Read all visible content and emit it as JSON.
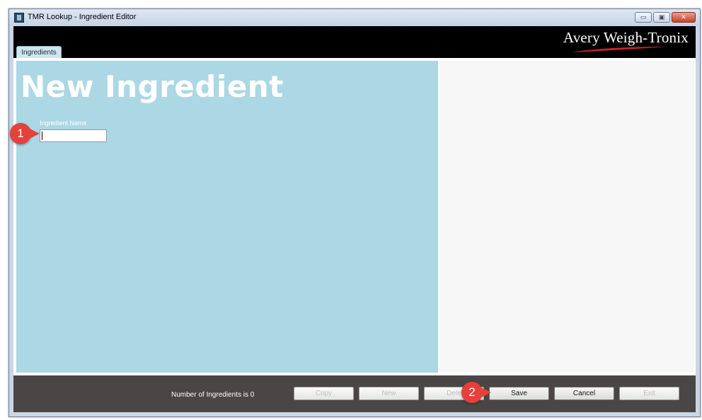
{
  "window": {
    "title": "TMR Lookup - Ingredient Editor",
    "controls": {
      "minimize": "▭",
      "maximize": "▣",
      "close": "✕"
    }
  },
  "header": {
    "logo_text": "Avery Weigh-Tronix",
    "tabs": [
      {
        "label": "Ingredients"
      }
    ]
  },
  "form": {
    "title": "New Ingredient",
    "name_label": "Ingredient Name",
    "name_value": "",
    "name_placeholder": ""
  },
  "footer": {
    "count_text": "Number of Ingredients is 0",
    "buttons": {
      "copy": "Copy",
      "new": "New",
      "delete": "Dele",
      "save": "Save",
      "cancel": "Cancel",
      "exit": "Exit"
    }
  },
  "annotations": {
    "marker1": "1",
    "marker2": "2"
  },
  "colors": {
    "panel_blue": "#acd7e4",
    "footer_dark": "#4a4645",
    "marker_red": "#e5403a"
  }
}
